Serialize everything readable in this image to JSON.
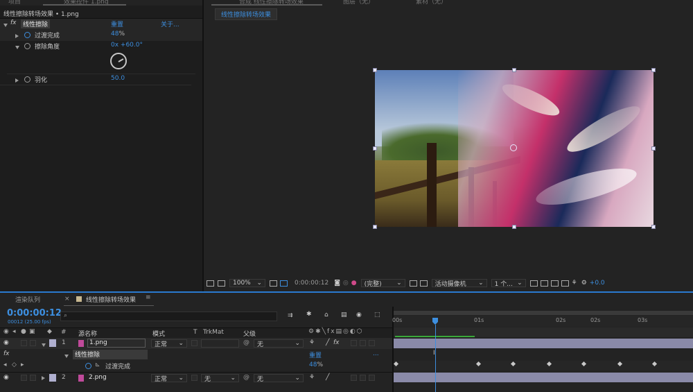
{
  "top_tabs": {
    "project": "项目",
    "effect_controls": "效果控件 1.png",
    "composition": "合成 线性擦除转场效果",
    "layer": "图层（无）",
    "footage": "素材（无）"
  },
  "effect_panel": {
    "breadcrumb": "线性擦除转场效果 • 1.png",
    "fx_label": "fx",
    "effect_name": "线性擦除",
    "reset": "重置",
    "about": "关于...",
    "props": [
      {
        "name": "过渡完成",
        "value": "48",
        "unit": "%"
      },
      {
        "name": "擦除角度",
        "value": "0x +60.0°"
      },
      {
        "name": "羽化",
        "value": "50.0"
      }
    ]
  },
  "viewer": {
    "comp_tab": "线性擦除转场效果",
    "zoom": "100%",
    "timecode": "0:00:00:12",
    "resolution": "(完整)",
    "camera": "活动摄像机",
    "views": "1 个...",
    "exposure": "+0.0"
  },
  "timeline": {
    "render_queue_tab": "渲染队列",
    "comp_tab": "线性擦除转场效果",
    "current_time": "0:00:00:12",
    "frame_info": "00012 (25.00 fps)",
    "search_placeholder": "",
    "headers": {
      "num": "#",
      "source": "源名称",
      "mode": "模式",
      "t": "T",
      "trkmat": "TrkMat",
      "parent": "父级"
    },
    "layers": [
      {
        "index": "1",
        "name": "1.png",
        "mode": "正常",
        "trkmat": "",
        "parent": "无"
      },
      {
        "index": "2",
        "name": "2.png",
        "mode": "正常",
        "trkmat": "无",
        "parent": "无"
      }
    ],
    "effect_row": {
      "fx": "fx",
      "name": "线性擦除",
      "reset": "重置",
      "more": "..."
    },
    "property_row": {
      "name": "过渡完成",
      "value": "48",
      "unit": "%"
    },
    "ruler": [
      "00s",
      "01s",
      "02s",
      "02s",
      "03s"
    ]
  },
  "colors": {
    "accent": "#3d8fe0",
    "layer_bar": "#8a8aa8",
    "work_area": "#3aa83a"
  }
}
